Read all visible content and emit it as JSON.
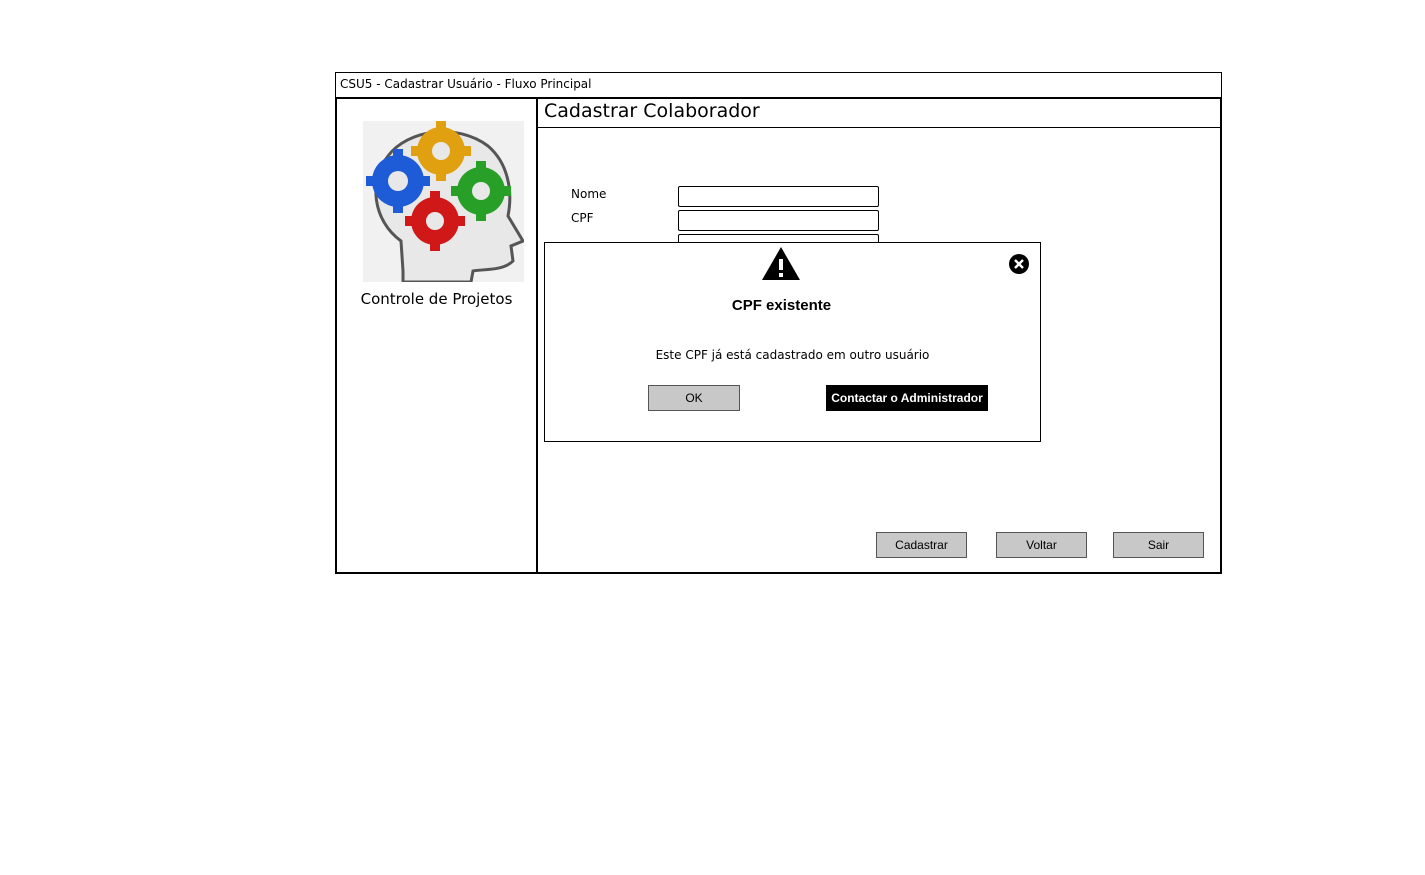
{
  "window": {
    "title": "CSU5 - Cadastrar Usuário - Fluxo Principal"
  },
  "sidebar": {
    "app_name": "Controle de Projetos"
  },
  "page": {
    "title": "Cadastrar Colaborador"
  },
  "form": {
    "fields": [
      {
        "label": "Nome",
        "value": ""
      },
      {
        "label": "CPF",
        "value": ""
      }
    ]
  },
  "footer": {
    "register_label": "Cadastrar",
    "back_label": "Voltar",
    "exit_label": "Sair"
  },
  "dialog": {
    "title": "CPF existente",
    "message": "Este CPF já está cadastrado em outro usuário",
    "ok_label": "OK",
    "contact_label": "Contactar o Administrador",
    "icons": {
      "warning": "warning-icon",
      "close": "close-icon"
    }
  },
  "colors": {
    "button_gray": "#c8c8c8",
    "dark_button": "#000000"
  }
}
